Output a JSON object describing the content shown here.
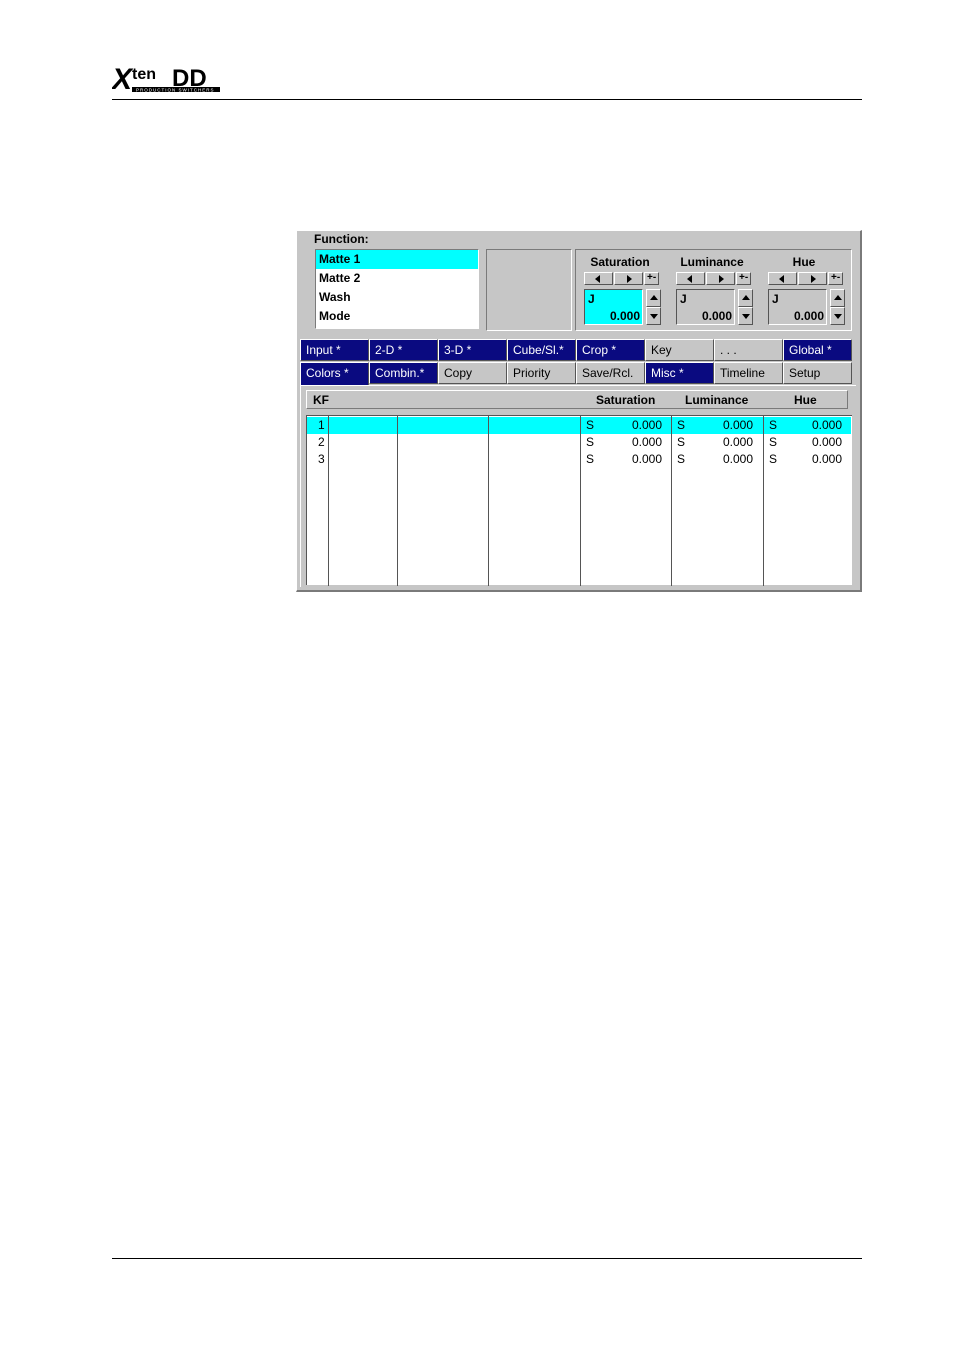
{
  "logo": {
    "text": "Xten DD",
    "tagline": "PRODUCTION SWITCHERS"
  },
  "function": {
    "label": "Function:",
    "items": [
      "Matte 1",
      "Matte 2",
      "Wash",
      "Mode"
    ],
    "selected": "Matte 1"
  },
  "params": [
    {
      "title": "Saturation",
      "unit": "J",
      "value": "0.000",
      "pm": "+-",
      "active": true
    },
    {
      "title": "Luminance",
      "unit": "J",
      "value": "0.000",
      "pm": "+-",
      "active": false
    },
    {
      "title": "Hue",
      "unit": "J",
      "value": "0.000",
      "pm": "+-",
      "active": false
    }
  ],
  "tabs": {
    "row1": [
      "Input *",
      "2-D *",
      "3-D *",
      "Cube/Sl.*",
      "Crop *",
      "Key",
      ". . .",
      "Global *"
    ],
    "row2": [
      "Colors *",
      "Combin.*",
      "Copy",
      "Priority",
      "Save/Rcl.",
      "Misc *",
      "Timeline",
      "Setup"
    ],
    "current": "Colors *"
  },
  "table": {
    "headers": {
      "kf": "KF",
      "saturation": "Saturation",
      "luminance": "Luminance",
      "hue": "Hue"
    },
    "rows": [
      {
        "kf": "1",
        "sat_flag": "S",
        "sat": "0.000",
        "lum_flag": "S",
        "lum": "0.000",
        "hue_flag": "S",
        "hue": "0.000"
      },
      {
        "kf": "2",
        "sat_flag": "S",
        "sat": "0.000",
        "lum_flag": "S",
        "lum": "0.000",
        "hue_flag": "S",
        "hue": "0.000"
      },
      {
        "kf": "3",
        "sat_flag": "S",
        "sat": "0.000",
        "lum_flag": "S",
        "lum": "0.000",
        "hue_flag": "S",
        "hue": "0.000"
      }
    ],
    "selected_row": "1"
  },
  "colors": {
    "highlight": "#00ffff",
    "panel": "#c6c6c6",
    "tab_marked": "#0a0a80"
  }
}
